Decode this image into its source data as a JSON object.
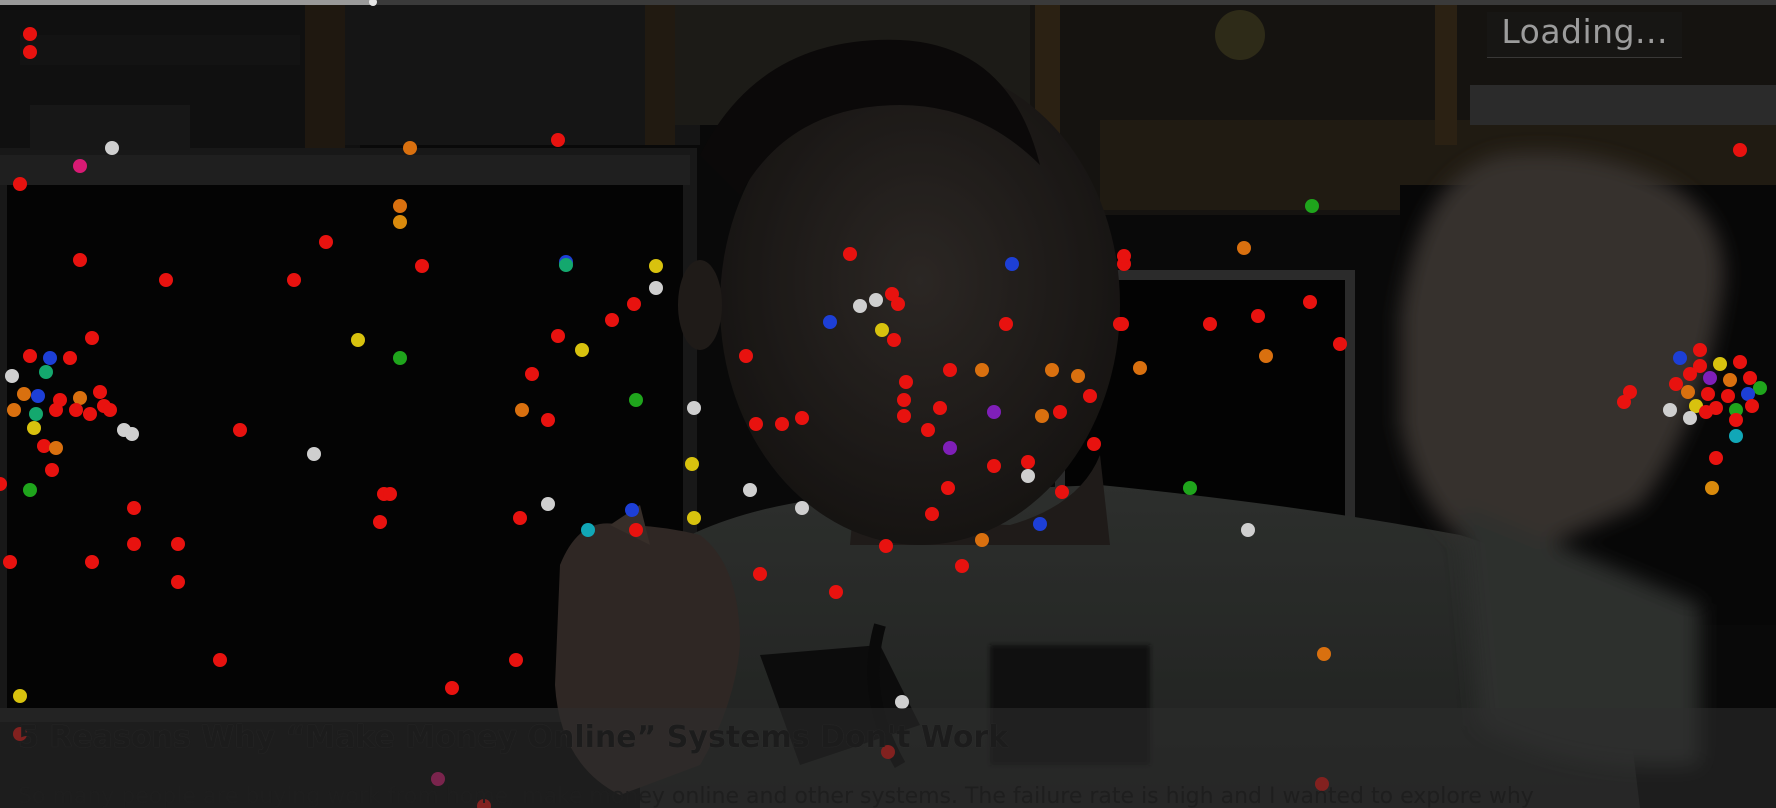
{
  "player": {
    "loading_text": "Loading...",
    "progress_fraction": 0.21
  },
  "video": {
    "title": "5 Reasons Why “Make Money Online” Systems Don't Work",
    "description": "So many people are buying work from home, make money online and other systems. The failure rate is high and I wanted to explore why"
  },
  "colors": {
    "red": "#e8120f",
    "orange": "#d9700f",
    "amber": "#d98a0c",
    "yellow": "#d8c20e",
    "green": "#1fa51c",
    "teal": "#14a86e",
    "cyan": "#11a7b7",
    "blue": "#1d3fd6",
    "purple": "#7f1fb8",
    "pink": "#d81a74",
    "white": "#cfcfcf"
  }
}
